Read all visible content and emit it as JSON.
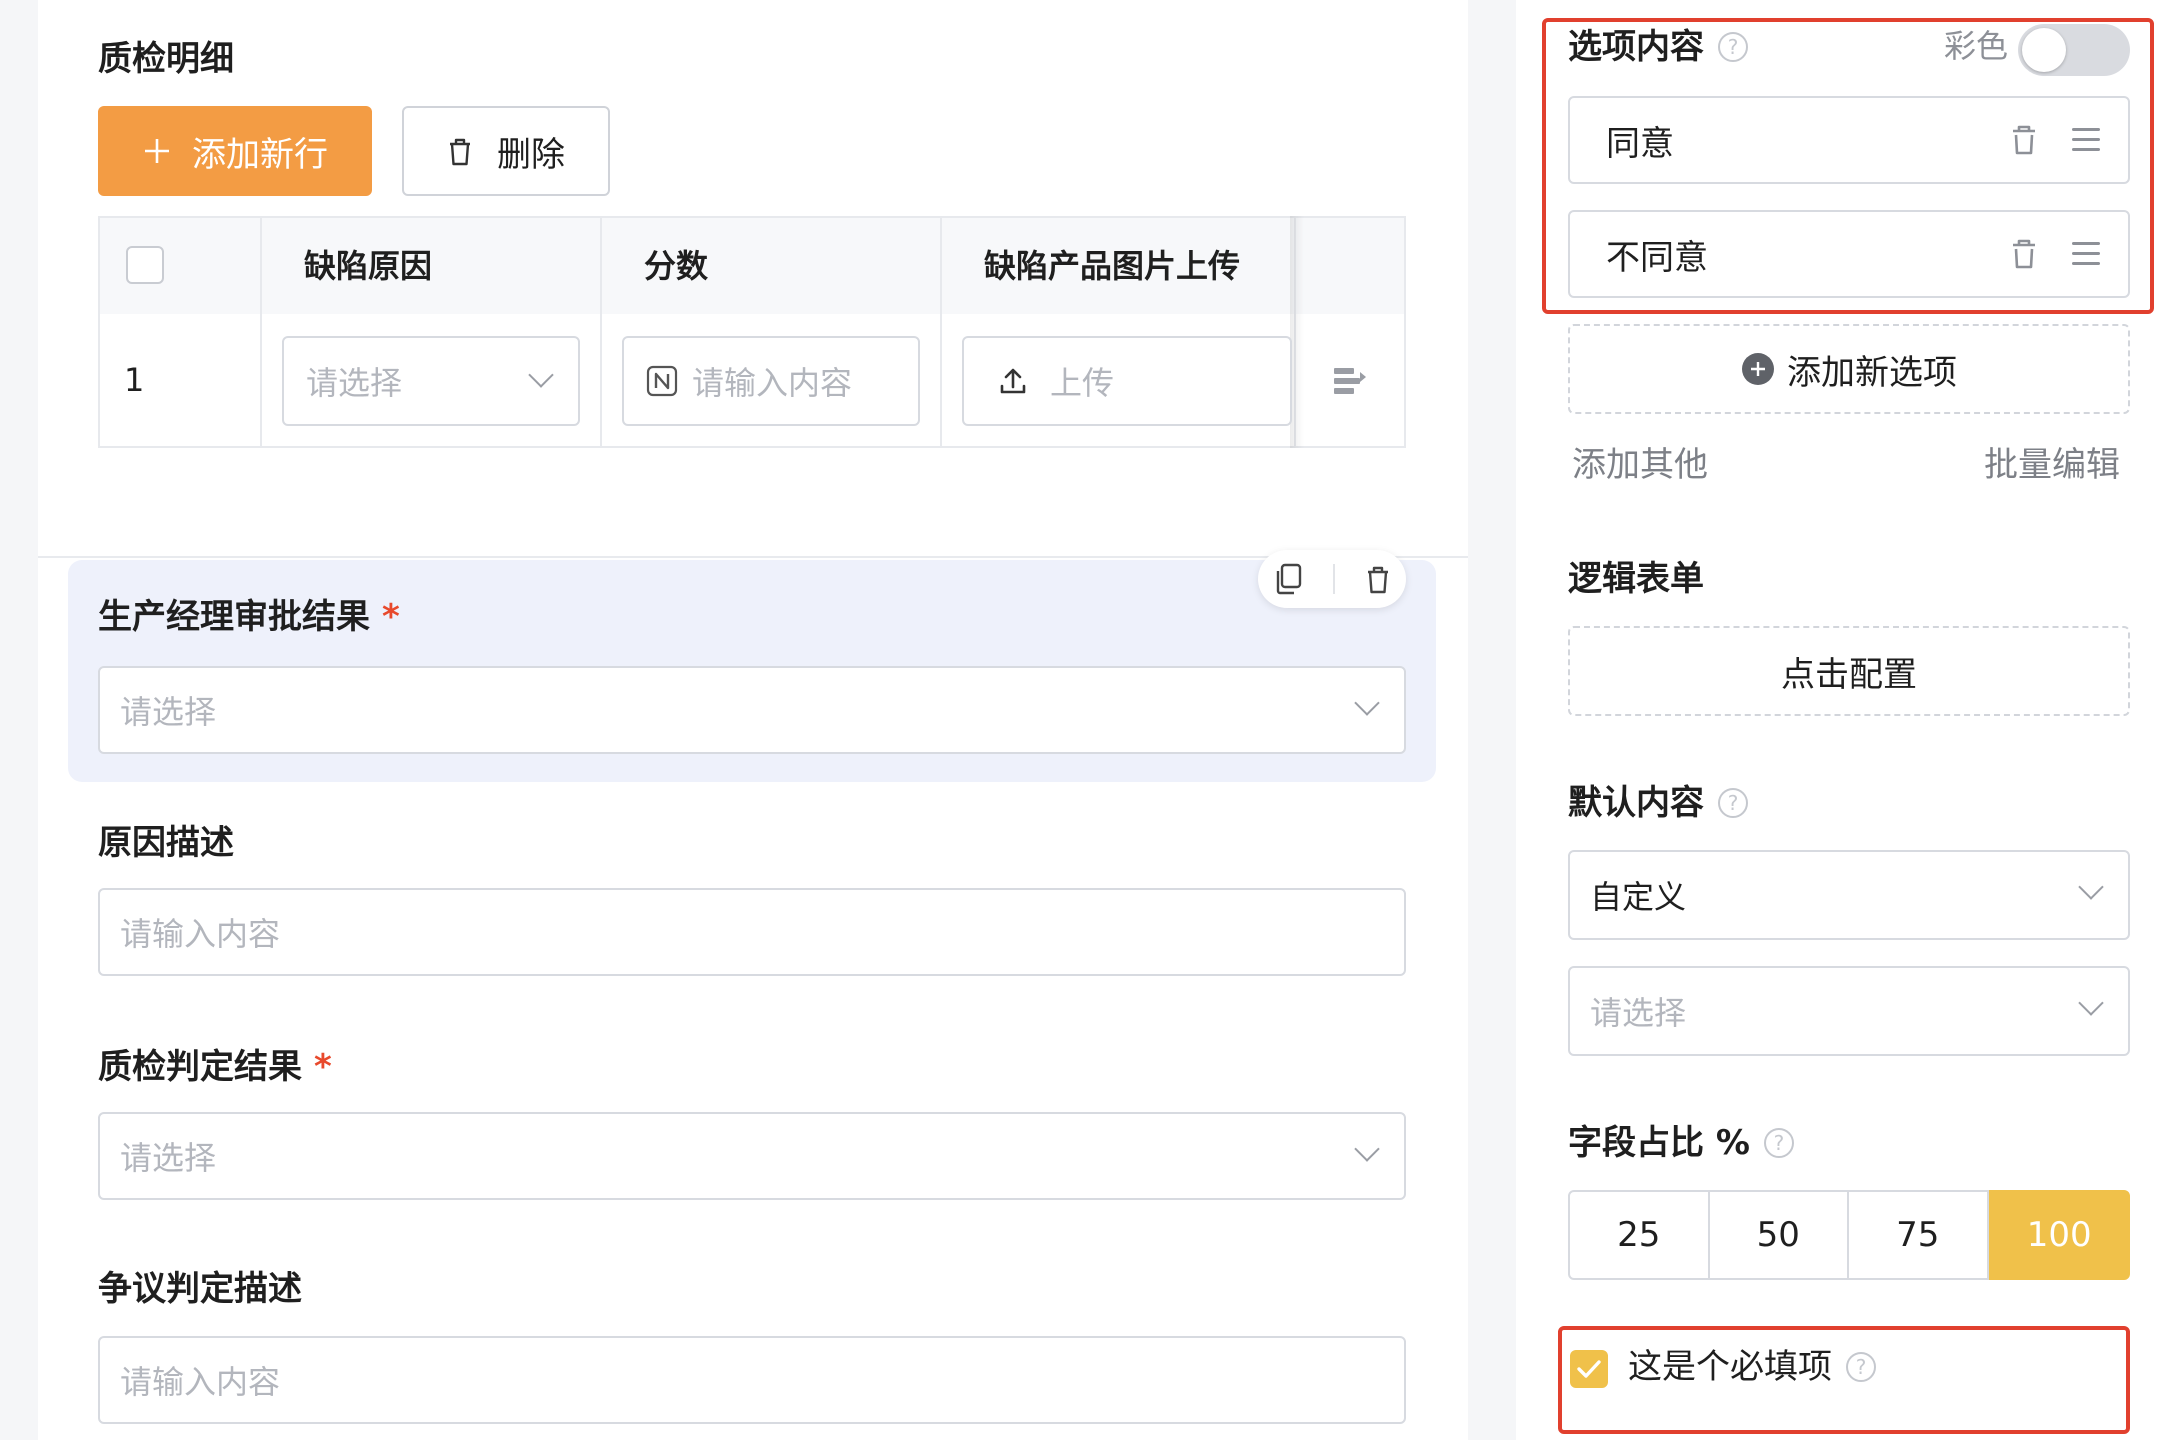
{
  "form": {
    "detail_section": {
      "title": "质检明细",
      "add_row_label": "添加新行",
      "delete_label": "删除",
      "columns": [
        "缺陷原因",
        "分数",
        "缺陷产品图片上传"
      ],
      "row": {
        "index": "1",
        "reason_placeholder": "请选择",
        "score_placeholder": "请输入内容",
        "upload_label": "上传"
      }
    },
    "fields": [
      {
        "label": "生产经理审批结果",
        "required": "*",
        "placeholder": "请选择"
      },
      {
        "label": "原因描述",
        "placeholder": "请输入内容"
      },
      {
        "label": "质检判定结果",
        "required": "*",
        "placeholder": "请选择"
      },
      {
        "label": "争议判定描述",
        "placeholder": "请输入内容"
      }
    ]
  },
  "settings": {
    "options_label": "选项内容",
    "color_label": "彩色",
    "color_enabled": false,
    "options": [
      "同意",
      "不同意"
    ],
    "add_option_label": "添加新选项",
    "add_other_label": "添加其他",
    "batch_edit_label": "批量编辑",
    "logic_label": "逻辑表单",
    "logic_button_label": "点击配置",
    "default_label": "默认内容",
    "default_mode": "自定义",
    "default_placeholder": "请选择",
    "width_label": "字段占比 %",
    "width_options": [
      "25",
      "50",
      "75",
      "100"
    ],
    "width_selected": "100",
    "required_label": "这是个必填项",
    "required_checked": true,
    "help_glyph": "?"
  },
  "colors": {
    "accent_orange": "#f39c44",
    "accent_yellow": "#f0c14a",
    "highlight_red": "#e1402e",
    "selected_bg": "#eef1fb"
  }
}
